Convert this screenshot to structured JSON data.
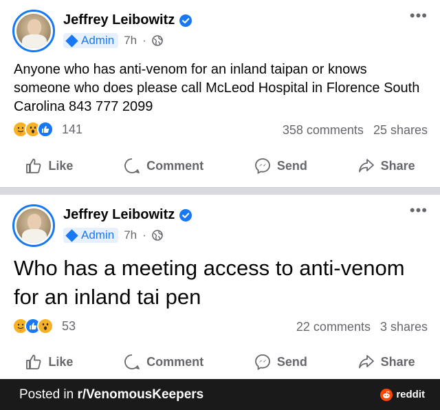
{
  "posts": [
    {
      "author": "Jeffrey Leibowitz",
      "role": "Admin",
      "time": "7h",
      "text": "Anyone who has anti-venom for an inland taipan or knows someone who does please call McLeod Hospital in Florence South Carolina 843  777 2099",
      "reaction_count": "141",
      "comments": "358 comments",
      "shares": "25 shares"
    },
    {
      "author": "Jeffrey Leibowitz",
      "role": "Admin",
      "time": "7h",
      "text": "Who has a meeting access to anti-venom for an inland tai pen",
      "reaction_count": "53",
      "comments": "22 comments",
      "shares": "3 shares"
    }
  ],
  "actions": {
    "like": "Like",
    "comment": "Comment",
    "send": "Send",
    "share": "Share"
  },
  "footer": {
    "prefix": "Posted in ",
    "subreddit": "r/VenomousKeepers",
    "brand": "reddit"
  },
  "colors": {
    "accent": "#1877f2",
    "muted": "#65676b",
    "footer_bg": "#1a1a1b",
    "reddit": "#ff4500"
  }
}
